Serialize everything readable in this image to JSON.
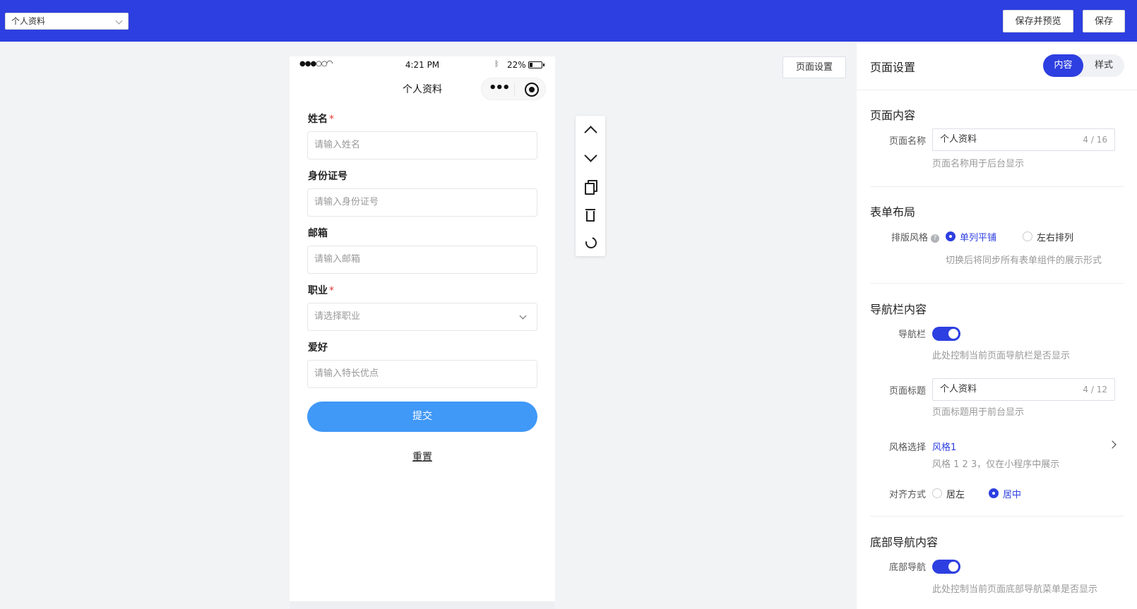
{
  "topbar": {
    "page_select_value": "个人资料",
    "save_preview_label": "保存并预览",
    "save_label": "保存"
  },
  "phone": {
    "status": {
      "signal": "●●●○○",
      "time": "4:21 PM",
      "battery": "22%"
    },
    "nav_title": "个人资料",
    "capsule_dots": "•••",
    "fields": [
      {
        "label": "姓名",
        "required": "*",
        "placeholder": "请输入姓名"
      },
      {
        "label": "身份证号",
        "placeholder": "请输入身份证号"
      },
      {
        "label": "邮箱",
        "placeholder": "请输入邮箱"
      },
      {
        "label": "职业",
        "required": "*",
        "placeholder": "请选择职业"
      },
      {
        "label": "爱好",
        "placeholder": "请输入特长优点"
      }
    ],
    "submit_label": "提交",
    "reset_label": "重置"
  },
  "canvas": {
    "page_setting_label": "页面设置"
  },
  "panel": {
    "title": "页面设置",
    "tab_content": "内容",
    "tab_style": "样式",
    "page_content": {
      "title": "页面内容",
      "name_label": "页面名称",
      "name_value": "个人资料",
      "name_count": "4 / 16",
      "name_hint": "页面名称用于后台显示"
    },
    "form_layout": {
      "title": "表单布局",
      "style_label": "排版风格",
      "help_mark": "?",
      "option_single": "单列平铺",
      "option_lr": "左右排列",
      "hint": "切换后将同步所有表单组件的展示形式"
    },
    "navbar": {
      "title": "导航栏内容",
      "switch_label": "导航栏",
      "switch_hint": "此处控制当前页面导航栏是否显示",
      "title_label": "页面标题",
      "title_value": "个人资料",
      "title_count": "4 / 12",
      "title_hint": "页面标题用于前台显示",
      "style_label": "风格选择",
      "style_value": "风格1",
      "style_hint": "风格 1 2 3，仅在小程序中展示",
      "align_label": "对齐方式",
      "align_left": "居左",
      "align_center": "居中"
    },
    "bottom_nav": {
      "title": "底部导航内容",
      "switch_label": "底部导航",
      "switch_hint": "此处控制当前页面底部导航菜单是否显示"
    }
  }
}
